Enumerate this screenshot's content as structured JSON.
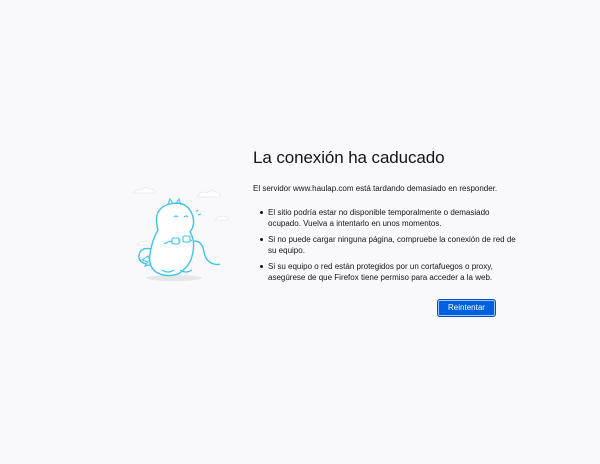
{
  "error": {
    "title": "La conexión ha caducado",
    "description": "El servidor www.haulap.com está tardando demasiado en responder.",
    "reasons": [
      "El sitio podría estar no disponible temporalmente o demasiado ocupado. Vuelva a intentarlo en unos momentos.",
      "Si no puede cargar ninguna página, compruebe la conexión de red de su equipo.",
      "Si su equipo o red están protegidos por un cortafuegos o proxy, asegúrese de que Firefox tiene permiso para acceder a la web."
    ],
    "retry_label": "Reintentar",
    "illustration_icon": "dinosaur-unplugged-cable-icon"
  },
  "colors": {
    "background": "#f9f9fb",
    "button": "#0061e0",
    "illustration": "#3fc3e6"
  }
}
